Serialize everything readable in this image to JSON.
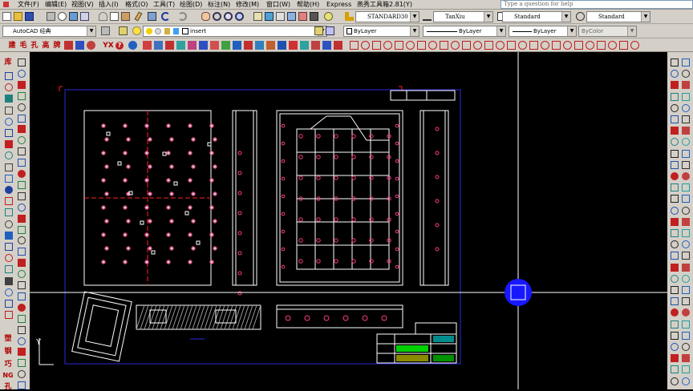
{
  "menubar": {
    "items": [
      "文件(F)",
      "编辑(E)",
      "视图(V)",
      "插入(I)",
      "格式(O)",
      "工具(T)",
      "绘图(D)",
      "标注(N)",
      "修改(M)",
      "窗口(W)",
      "帮助(H)",
      "Express",
      "燕秀工具箱2.81(Y)"
    ],
    "help_placeholder": "Type a question for help"
  },
  "styles_toolbar": {
    "text_style": "STANDARD30",
    "dim_style": "TanXiu",
    "table_style": "Standard",
    "mleader_style": "Standard"
  },
  "workspace_toolbar": {
    "workspace": "AutoCAD 经典",
    "layer": "insert"
  },
  "properties_toolbar": {
    "color": "ByLayer",
    "linetype": "ByLayer",
    "lineweight": "ByLayer",
    "plotstyle": "ByColor"
  },
  "yanxiu_toolbar": {
    "chars": [
      "建",
      "毛",
      "孔",
      "高",
      "牌",
      "YX",
      "?"
    ]
  },
  "left_toolbar": {
    "chars": [
      "库",
      "塑",
      "钢",
      "巧",
      "NG",
      "孔"
    ]
  },
  "icons": [
    "new-icon",
    "open-icon",
    "save-icon",
    "print-icon",
    "preview-icon",
    "publish-icon",
    "cut-icon",
    "copy-icon",
    "paste-icon",
    "matchprop-icon",
    "undo-icon",
    "redo-icon",
    "pan-icon",
    "zoom-icon",
    "zoom-prev-icon",
    "properties-icon",
    "designcenter-icon",
    "toolpalette-icon",
    "sheetset-icon",
    "markup-icon",
    "calc-icon",
    "help-icon",
    "layer-manager-icon",
    "layer-state-icon",
    "lightbulb-icon",
    "sun-icon",
    "lock-icon",
    "color-swatch-icon",
    "make-current-icon",
    "layer-previous-icon",
    "crosshair-cursor-icon",
    "ucs-icon"
  ],
  "canvas": {
    "ucs_y": "Y",
    "colors": {
      "sheet_frame": "#2a2ad8",
      "drawing": "#ffffff",
      "holes": "#ff3a8a",
      "centerline": "#ff2020",
      "cursor": "#ffffff",
      "pickbox": "#1818ff",
      "title_green": "#00d000",
      "title_cyan": "#00c8c8",
      "title_yellow": "#e8e800"
    }
  }
}
